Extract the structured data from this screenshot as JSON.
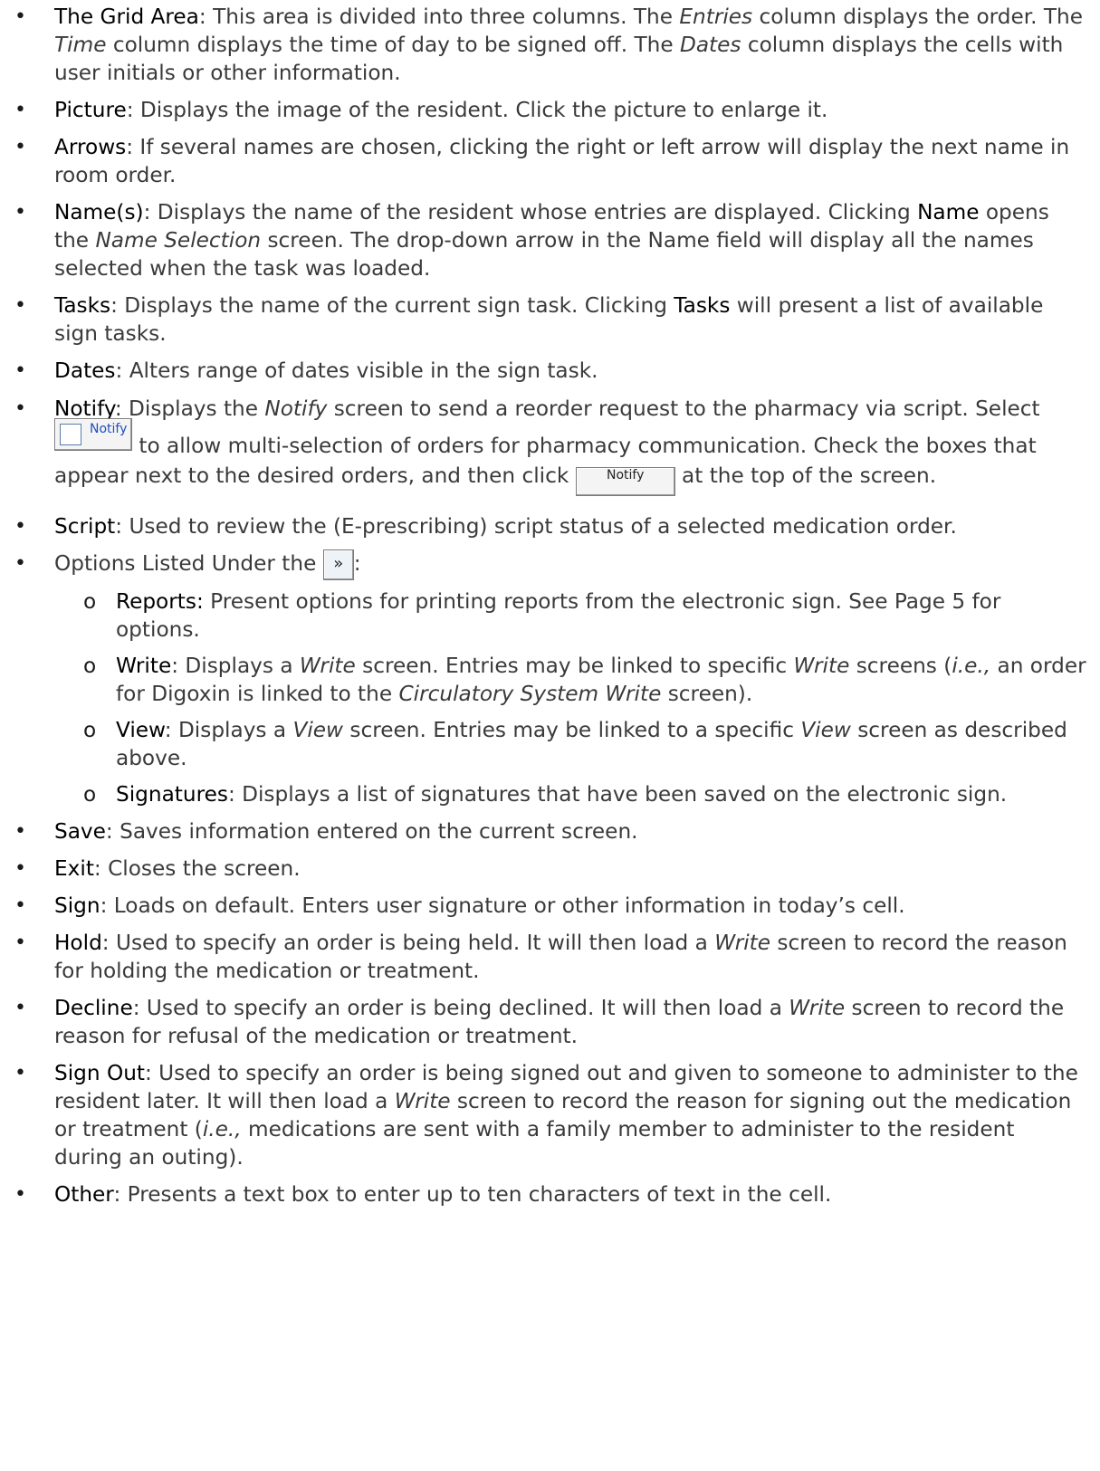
{
  "items": [
    {
      "term": "The Grid Area",
      "t1": ": This area is divided into three columns. The ",
      "e1": "Entries",
      "t2": " column displays the order. The ",
      "e2": "Time",
      "t3": " column displays the time of day to be signed off. The ",
      "e3": "Dates",
      "t4": " column displays the cells with user initials or other information."
    },
    {
      "term": "Picture",
      "text": ": Displays the image of the resident. Click the picture to enlarge it."
    },
    {
      "term": "Arrows",
      "text": ": If several names are chosen, clicking the right or left arrow will display the next name in room order."
    },
    {
      "term": "Name(s)",
      "t1": ": Displays the name of the resident whose entries are displayed. Clicking ",
      "term2": "Name",
      "t2": " opens the ",
      "e1": "Name Selection",
      "t3": " screen. The drop-down arrow in the Name field will display all the names selected when the task was loaded."
    },
    {
      "term": "Tasks",
      "t1": ": Displays the name of the current sign task. Clicking ",
      "term2": "Tasks",
      "t2": " will present a list of available sign tasks."
    },
    {
      "term": "Dates",
      "text": ": Alters range of dates visible in the sign task."
    },
    {
      "term": "Notify",
      "t1": ": Displays the ",
      "e1": "Notify",
      "t2": " screen to send a reorder request to the pharmacy via script. Select ",
      "t3": " to allow multi-selection of orders for pharmacy communication. Check the boxes that appear next to the desired orders, and then click ",
      "t4": " at the top of the screen.",
      "btn_checkbox_label": "Notify",
      "btn_label": "Notify"
    },
    {
      "term": "Script",
      "text": ": Used to review the (E-prescribing) script status of a selected medication order."
    },
    {
      "lead": "Options Listed Under the ",
      "tail": ":",
      "more_icon": "double-chevron-right-icon"
    },
    {
      "term": "Save",
      "text": ": Saves information entered on the current screen."
    },
    {
      "term": "Exit",
      "text": ": Closes the screen."
    },
    {
      "term": "Sign",
      "text": ": Loads on default. Enters user signature or other information in today’s cell."
    },
    {
      "term": "Hold",
      "t1": ": Used to specify an order is being held.  It will then load a ",
      "e1": "Write",
      "t2": " screen to record the reason for holding the medication or treatment."
    },
    {
      "term": "Decline",
      "t1": ": Used to specify an order is being declined.  It will then load a ",
      "e1": "Write",
      "t2": " screen to record the reason for refusal of the medication or treatment."
    },
    {
      "term": "Sign Out",
      "t1": ": Used to specify an order is being signed out and given to someone to administer to the resident later.  It will then load a ",
      "e1": "Write",
      "t2": " screen to record the reason for signing out the medication or treatment (",
      "e2": "i.e.,",
      "t3": " medications are sent with a family member to administer to the resident during an outing)."
    },
    {
      "term": "Other",
      "text": ": Presents a text box to enter up to ten characters of text in the cell."
    }
  ],
  "options": [
    {
      "term": "Reports:",
      "text": " Present options for printing reports from the electronic sign.  See Page 5 for options."
    },
    {
      "term": "Write",
      "t1": ": Displays a ",
      "e1": "Write",
      "t2": " screen. Entries may be linked to specific ",
      "e2": "Write",
      "t3": " screens (",
      "e3": "i.e.,",
      "t4": " an order for Digoxin is linked to the ",
      "e4": "Circulatory System Write",
      "t5": " screen)."
    },
    {
      "term": "View",
      "t1": ": Displays a ",
      "e1": "View",
      "t2": " screen. Entries may be linked to a specific ",
      "e2": "View",
      "t3": " screen as described above."
    },
    {
      "term": "Signatures",
      "text": ": Displays a list of signatures that have been saved on the electronic sign."
    }
  ]
}
